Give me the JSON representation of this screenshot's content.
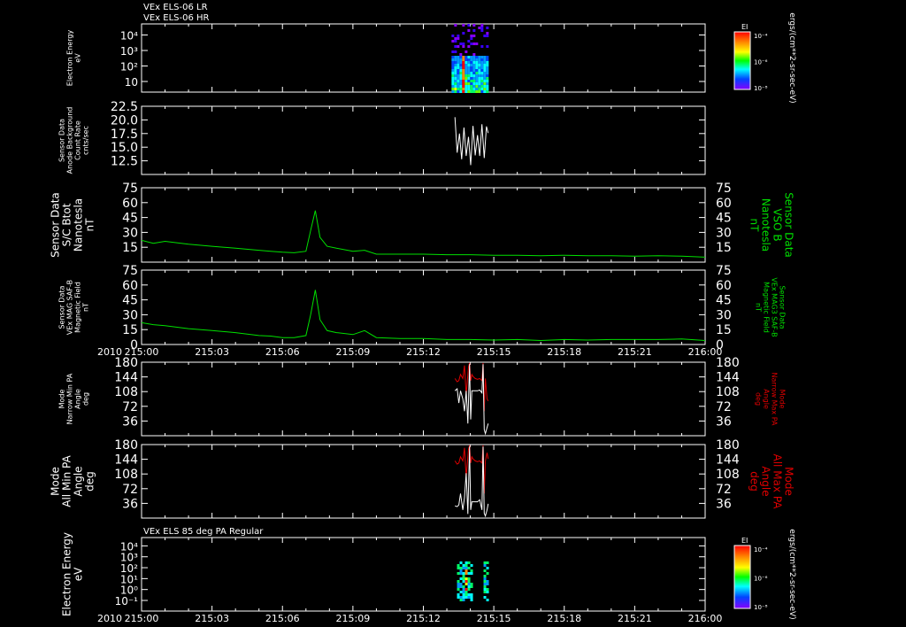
{
  "chart_data": {
    "type": "line",
    "top_labels": [
      "VEx ELS-06 LR",
      "VEx ELS-06 HR"
    ],
    "time_axis": {
      "ticks": [
        "215:00",
        "215:03",
        "215:06",
        "215:09",
        "215:12",
        "215:15",
        "215:18",
        "215:21",
        "216:00"
      ],
      "year_label": "2010"
    },
    "panels": [
      {
        "kind": "spectrogram",
        "ylabel": [
          "Electron Energy",
          "eV"
        ],
        "yticks": [
          "10",
          "10²",
          "10³",
          "10⁴"
        ],
        "colorbar": {
          "title": "EI",
          "ticks": [
            "10⁻⁴",
            "10⁻⁶",
            "10⁻⁸"
          ],
          "unit": "ergs/(cm**2-sr-sec-eV)"
        },
        "data_range": [
          55,
          61.5
        ]
      },
      {
        "kind": "line",
        "ylabel": [
          "Sensor Data",
          "Anode Background",
          "Count Rate",
          "cnts/sec"
        ],
        "yticks": [
          "12.5",
          "15.0",
          "17.5",
          "20.0",
          "22.5"
        ],
        "ylim": [
          10,
          22.5
        ],
        "series": [
          {
            "color": "#ffffff",
            "x": [
              55.6,
              56.0,
              56.4,
              56.8,
              57.2,
              57.6,
              58.0,
              58.4,
              58.8,
              59.2,
              59.6,
              60.0,
              60.4,
              60.8,
              61.2,
              61.5
            ],
            "y": [
              20.5,
              14.0,
              17.5,
              12.8,
              18.6,
              13.4,
              16.9,
              11.7,
              18.9,
              13.5,
              17.2,
              13.4,
              19.2,
              13.0,
              18.8,
              17.6
            ]
          }
        ]
      },
      {
        "kind": "line",
        "ylabel": [
          "Sensor Data",
          "S/C Btot",
          "Nanotesla",
          "nT"
        ],
        "right_label": [
          "Sensor Data",
          "VSO B",
          "Nanotesla",
          "nT"
        ],
        "right_color": "#00e000",
        "yticks": [
          "15",
          "30",
          "45",
          "60",
          "75"
        ],
        "ylim": [
          0,
          75
        ],
        "series": [
          {
            "color": "#00e000",
            "x": [
              0,
              0.5,
              1,
              2,
              3,
              4,
              5,
              5.5,
              6,
              6.5,
              7,
              7.2,
              7.4,
              7.6,
              7.9,
              8.3,
              9.0,
              9.5,
              10,
              11,
              12,
              13,
              14,
              15,
              16,
              17,
              18,
              19,
              20,
              21,
              22,
              23,
              24
            ],
            "y": [
              22,
              19,
              21,
              18,
              16,
              14,
              12,
              11,
              10,
              9.5,
              11,
              32,
              52,
              25,
              16,
              14,
              11,
              12,
              8,
              8,
              8,
              7.5,
              7.5,
              7,
              7,
              6.5,
              7,
              6.5,
              6.5,
              6,
              6.5,
              6,
              5
            ]
          }
        ]
      },
      {
        "kind": "line",
        "ylabel": [
          "Sensor Data",
          "VEx MAG SAF-B",
          "Magnetic Field",
          "nT"
        ],
        "right_label": [
          "Sensor Data",
          "VEx MAG3 SAF-B",
          "Magnetic Field",
          "nT"
        ],
        "right_color": "#00e000",
        "yticks": [
          "0",
          "15",
          "30",
          "45",
          "60",
          "75"
        ],
        "ylim": [
          0,
          75
        ],
        "series": [
          {
            "color": "#00e000",
            "x": [
              0,
              0.5,
              1,
              2,
              3,
              4,
              5,
              5.5,
              6,
              6.5,
              7,
              7.2,
              7.4,
              7.6,
              7.9,
              8.3,
              9.0,
              9.5,
              10,
              11,
              12,
              13,
              14,
              15,
              16,
              17,
              18,
              19,
              20,
              21,
              22,
              23,
              24
            ],
            "y": [
              22,
              20,
              19,
              16,
              14,
              12,
              9,
              8.5,
              7,
              7,
              9,
              30,
              55,
              25,
              14,
              12,
              10,
              14,
              7,
              6,
              6,
              5,
              5,
              4.5,
              5,
              4,
              5,
              4.5,
              5,
              5,
              5,
              5.5,
              4
            ]
          }
        ]
      },
      {
        "kind": "line",
        "ylabel": [
          "Mode",
          "Narrow Min PA",
          "Angle",
          "deg"
        ],
        "right_label": [
          "Mode",
          "Narrow Max PA",
          "Angle",
          "deg"
        ],
        "right_color": "#e00000",
        "yticks": [
          "36",
          "72",
          "108",
          "144",
          "180"
        ],
        "ylim": [
          0,
          180
        ],
        "series": [
          {
            "color": "#e00000",
            "x": [
              55.6,
              56.0,
              56.3,
              56.6,
              57.0,
              57.3,
              57.6,
              58.0,
              58.2,
              58.4,
              58.6,
              58.8,
              59.2,
              59.6,
              60.0,
              60.4,
              60.6,
              60.8,
              61.0,
              61.3,
              61.5
            ],
            "y": [
              140,
              132,
              135,
              150,
              140,
              172,
              100,
              168,
              178,
              135,
              150,
              145,
              140,
              138,
              140,
              135,
              178,
              60,
              140,
              90,
              85
            ]
          },
          {
            "color": "#ffffff",
            "x": [
              55.6,
              56.0,
              56.3,
              56.6,
              57.0,
              57.3,
              57.6,
              57.9,
              58.2,
              58.4,
              58.6,
              58.8,
              59.2,
              59.6,
              60.0,
              60.4,
              60.6,
              60.8,
              61.0,
              61.3,
              61.5
            ],
            "y": [
              110,
              115,
              80,
              110,
              90,
              60,
              110,
              30,
              175,
              40,
              110,
              110,
              110,
              110,
              112,
              105,
              175,
              15,
              5,
              20,
              30
            ]
          }
        ]
      },
      {
        "kind": "line",
        "ylabel": [
          "Mode",
          "All Min PA",
          "Angle",
          "deg"
        ],
        "right_label": [
          "Mode",
          "All Max PA",
          "Angle",
          "deg"
        ],
        "right_color": "#e00000",
        "yticks": [
          "36",
          "72",
          "108",
          "144",
          "180"
        ],
        "ylim": [
          0,
          180
        ],
        "series": [
          {
            "color": "#e00000",
            "x": [
              55.6,
              56.0,
              56.3,
              56.6,
              57.0,
              57.3,
              57.6,
              58.0,
              58.2,
              58.4,
              58.6,
              58.8,
              59.2,
              59.6,
              60.0,
              60.4,
              60.6,
              60.8,
              61.0,
              61.3,
              61.5
            ],
            "y": [
              140,
              132,
              135,
              150,
              140,
              172,
              100,
              168,
              178,
              135,
              150,
              145,
              140,
              138,
              140,
              135,
              178,
              60,
              140,
              160,
              145
            ]
          },
          {
            "color": "#ffffff",
            "x": [
              55.6,
              56.0,
              56.3,
              56.6,
              57.0,
              57.3,
              57.6,
              57.9,
              58.2,
              58.4,
              58.6,
              58.8,
              59.2,
              59.6,
              60.0,
              60.4,
              60.6,
              60.8,
              61.0,
              61.3,
              61.5
            ],
            "y": [
              30,
              28,
              32,
              60,
              20,
              50,
              110,
              10,
              175,
              20,
              40,
              40,
              40,
              40,
              45,
              20,
              175,
              12,
              5,
              20,
              35
            ]
          }
        ]
      },
      {
        "kind": "spectrogram",
        "title": "VEx ELS 85 deg PA Regular",
        "ylabel": [
          "Electron Energy",
          "eV"
        ],
        "yticks": [
          "10⁻¹",
          "10⁰",
          "10¹",
          "10²",
          "10³",
          "10⁴"
        ],
        "colorbar": {
          "title": "EI",
          "ticks": [
            "10⁻⁴",
            "10⁻⁶",
            "10⁻⁸"
          ],
          "unit": "ergs/(cm**2-sr-sec-eV)"
        },
        "data_range": [
          55.5,
          61.5
        ]
      }
    ]
  },
  "colors": {
    "background": "#000000",
    "axis": "#ffffff",
    "green": "#00e000",
    "red": "#e00000"
  }
}
